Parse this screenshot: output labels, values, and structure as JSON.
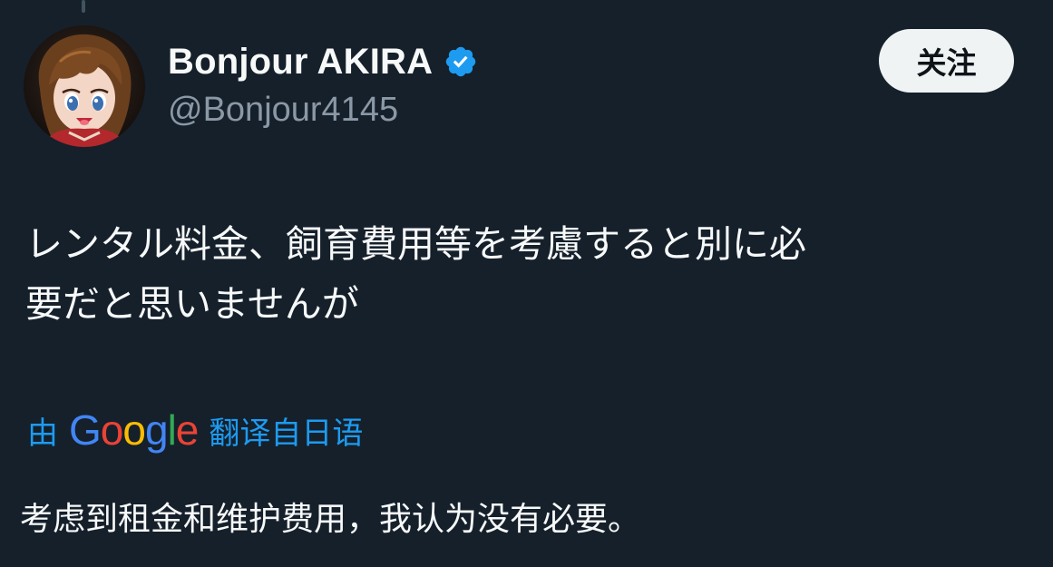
{
  "tweet": {
    "author": {
      "display_name": "Bonjour AKIRA",
      "handle": "@Bonjour4145",
      "verified": true,
      "verified_icon": "verified-badge-icon"
    },
    "follow_label": "关注",
    "text": "レンタル料金、飼育費用等を考慮すると別に必\n要だと思いませんが",
    "translation": {
      "prefix": "由",
      "provider_letters": [
        "G",
        "o",
        "o",
        "g",
        "l",
        "e"
      ],
      "suffix": "翻译自日语",
      "text": "考虑到租金和维护费用，我认为没有必要。"
    }
  },
  "colors": {
    "background": "#15202b",
    "primary_text": "#f7f9f9",
    "secondary_text": "#8b98a5",
    "link": "#1d9bf0",
    "verified": "#1d9bf0",
    "follow_button_bg": "#eff3f4",
    "google_blue": "#4285f4",
    "google_red": "#ea4335",
    "google_yellow": "#fbbc05",
    "google_green": "#34a853"
  }
}
